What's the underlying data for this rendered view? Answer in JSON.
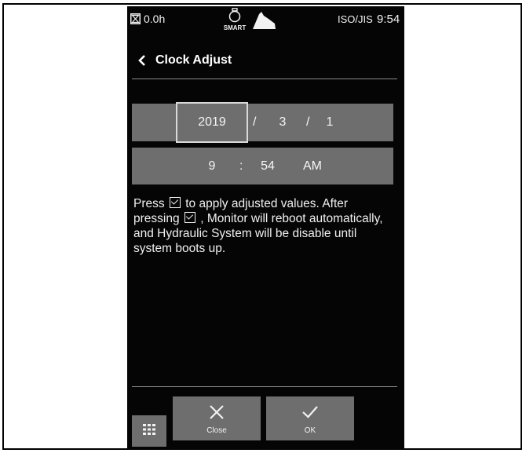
{
  "statusbar": {
    "hour_meter": "0.0h",
    "smart_label": "SMART",
    "pattern": "ISO/JIS",
    "clock": "9:54"
  },
  "header": {
    "title": "Clock Adjust"
  },
  "date": {
    "year": "2019",
    "separator": "/",
    "month": "3",
    "day": "1"
  },
  "time": {
    "hour": "9",
    "separator": ":",
    "minute": "54",
    "ampm": "AM"
  },
  "info": {
    "part1": "Press",
    "part2": "to apply adjusted values. After pressing",
    "part3": ", Monitor will reboot automatically, and Hydraulic System will be disable until system boots up."
  },
  "footer": {
    "close_label": "Close",
    "ok_label": "OK"
  },
  "icons": {
    "status": [
      "hourglass-icon",
      "smart-engine-icon",
      "work-mode-icon"
    ],
    "header": "chevron-left-icon",
    "footer": [
      "grid-menu-icon",
      "close-icon",
      "check-icon"
    ]
  },
  "colors": {
    "screen_bg": "#050505",
    "field_bg": "#6e6e6e",
    "text": "#f0f0f0",
    "selected_border": "#d9d9d9"
  }
}
